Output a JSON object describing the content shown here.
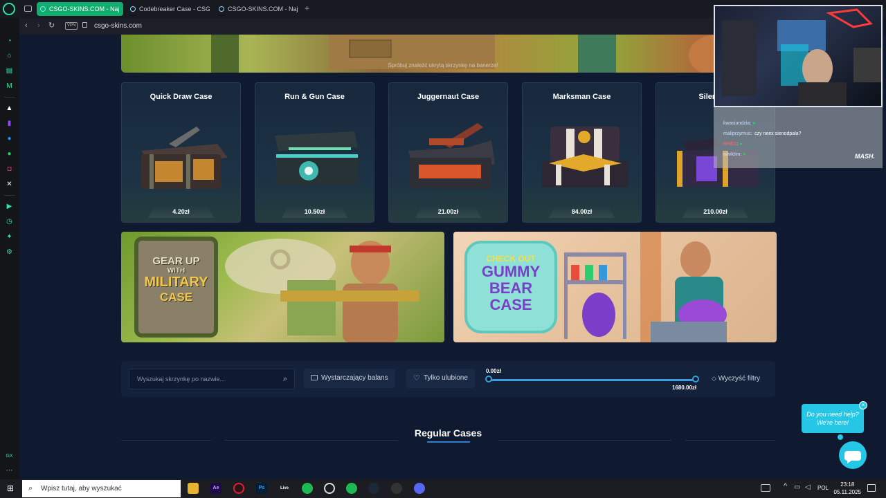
{
  "browser": {
    "tabs": [
      {
        "label": "CSGO-SKINS.COM - Naj",
        "active": true
      },
      {
        "label": "Codebreaker Case - CSG",
        "active": false
      },
      {
        "label": "CSGO-SKINS.COM - Naj",
        "active": false
      }
    ],
    "new_tab": "+",
    "vpn_badge": "VPN",
    "url": "csgo-skins.com",
    "sidebar_badge": "GX"
  },
  "banner": {
    "hint": "Spróbuj znaleźć ukrytą skrzynkę na banerze!"
  },
  "cases": [
    {
      "name": "Quick Draw Case",
      "price": "4.20zł"
    },
    {
      "name": "Run & Gun Case",
      "price": "10.50zł"
    },
    {
      "name": "Juggernaut Case",
      "price": "21.00zł"
    },
    {
      "name": "Marksman Case",
      "price": "84.00zł"
    },
    {
      "name": "Silent Str",
      "price": "210.00zł"
    }
  ],
  "promos": {
    "left": {
      "line1": "GEAR UP",
      "line2": "WITH",
      "line3": "MILITARY",
      "line4": "CASE"
    },
    "right": {
      "line1": "CHECK OUT",
      "line2": "GUMMY",
      "line3": "BEAR",
      "line4": "CASE"
    }
  },
  "filters": {
    "search_placeholder": "Wyszukaj skrzynkę po nazwie...",
    "balance_label": "Wystarczający balans",
    "favorites_label": "Tylko ulubione",
    "price_min": "0.00zł",
    "price_max": "1680.00zł",
    "clear_label": "Wyczyść filtry"
  },
  "section": {
    "title": "Regular Cases"
  },
  "stream_chat": [
    {
      "user": "kwasiundzia",
      "msg": ""
    },
    {
      "user": "maliprzymus",
      "msg": "czy neex sienodpala?"
    },
    {
      "user": "RHEX",
      "msg": ""
    },
    {
      "user": "wwiktim",
      "msg": ""
    }
  ],
  "stream_logo": "MASH.",
  "help": {
    "line1": "Do you need help?",
    "line2": "We're here!",
    "close": "×"
  },
  "taskbar": {
    "search_placeholder": "Wpisz tutaj, aby wyszukać",
    "time": "23:18",
    "date": "05.11.2025",
    "lang": "POL",
    "live_label": "Live",
    "ps_label": "Ps",
    "ae_label": "Ae"
  }
}
